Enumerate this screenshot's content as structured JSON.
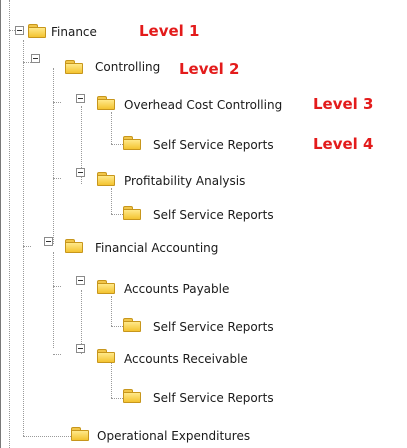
{
  "tree": {
    "nodes": [
      {
        "label": "Finance",
        "level_tag": "Level 1",
        "expanded": true,
        "icon": "folder-icon"
      },
      {
        "label": "Controlling",
        "level_tag": "Level 2",
        "expanded": true,
        "icon": "folder-icon"
      },
      {
        "label": "Overhead Cost Controlling",
        "level_tag": "Level 3",
        "expanded": true,
        "icon": "folder-icon"
      },
      {
        "label": "Self Service Reports",
        "level_tag": "Level 4",
        "expanded": false,
        "icon": "folder-icon"
      },
      {
        "label": "Profitability Analysis",
        "level_tag": "",
        "expanded": true,
        "icon": "folder-icon"
      },
      {
        "label": "Self Service Reports",
        "level_tag": "",
        "expanded": false,
        "icon": "folder-icon"
      },
      {
        "label": "Financial Accounting",
        "level_tag": "",
        "expanded": true,
        "icon": "folder-icon"
      },
      {
        "label": "Accounts Payable",
        "level_tag": "",
        "expanded": true,
        "icon": "folder-icon"
      },
      {
        "label": "Self Service Reports",
        "level_tag": "",
        "expanded": false,
        "icon": "folder-icon"
      },
      {
        "label": "Accounts Receivable",
        "level_tag": "",
        "expanded": true,
        "icon": "folder-icon"
      },
      {
        "label": "Self Service Reports",
        "level_tag": "",
        "expanded": false,
        "icon": "folder-icon"
      },
      {
        "label": "Operational Expenditures",
        "level_tag": "",
        "expanded": false,
        "icon": "folder-icon"
      }
    ],
    "colors": {
      "level_tag": "#e31b1b",
      "folder_fill": "#f3c330",
      "folder_border": "#c7961c",
      "connector": "#9a9a9a"
    }
  }
}
